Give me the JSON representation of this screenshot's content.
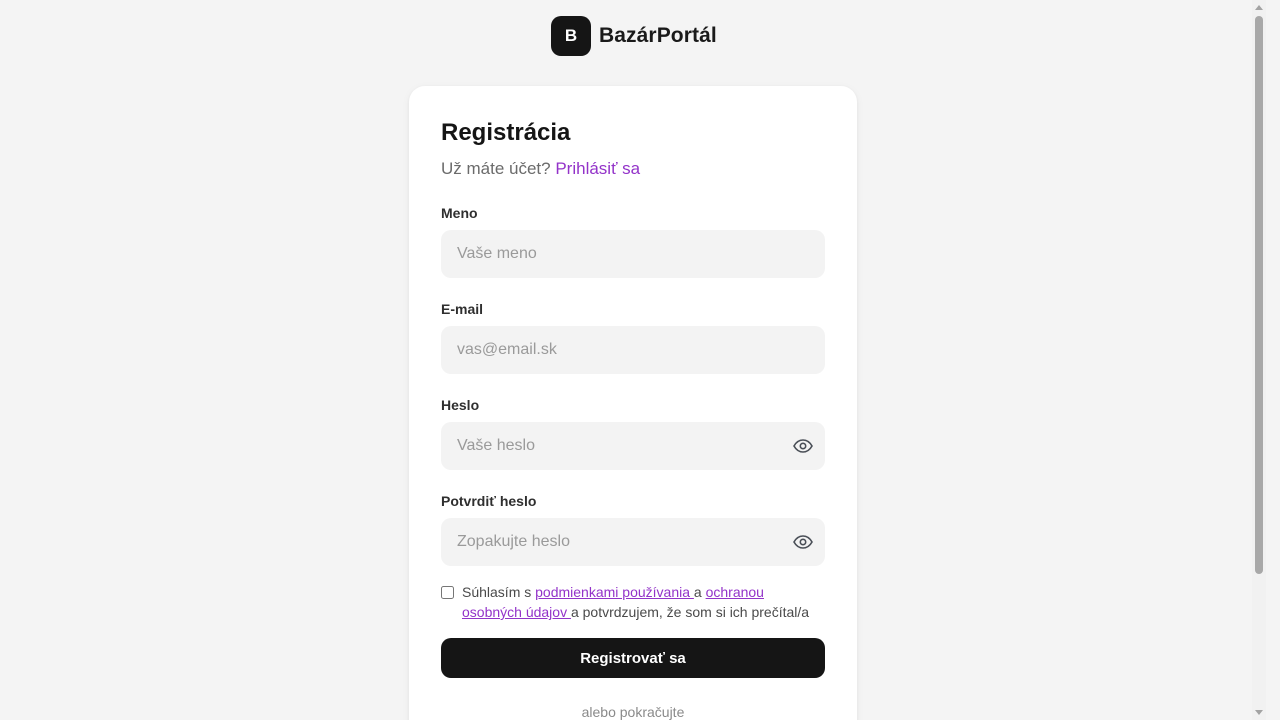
{
  "brand": {
    "logo_letter": "B",
    "name": "BazárPortál"
  },
  "form": {
    "title": "Registrácia",
    "subtitle_text": "Už máte účet?",
    "login_link": "Prihlásiť sa",
    "fields": {
      "name": {
        "label": "Meno",
        "placeholder": "Vaše meno",
        "value": ""
      },
      "email": {
        "label": "E-mail",
        "placeholder": "vas@email.sk",
        "value": ""
      },
      "password": {
        "label": "Heslo",
        "placeholder": "Vaše heslo",
        "value": ""
      },
      "confirm": {
        "label": "Potvrdiť heslo",
        "placeholder": "Zopakujte heslo",
        "value": ""
      }
    },
    "terms": {
      "checked": false,
      "prefix": "Súhlasím s ",
      "terms_link": "podmienkami používania ",
      "middle": "a ",
      "privacy_link": "ochranou osobných údajov ",
      "suffix": "a potvrdzujem, že som si ich prečítal/a"
    },
    "submit_label": "Registrovať sa",
    "footer_text": "alebo pokračujte"
  },
  "colors": {
    "accent": "#9333c9",
    "primary_button": "#151515",
    "background": "#f4f4f4",
    "input_bg": "#f3f3f3"
  },
  "icons": {
    "logo": "letter-logo",
    "password_toggle": "eye-icon",
    "confirm_toggle": "eye-icon"
  }
}
